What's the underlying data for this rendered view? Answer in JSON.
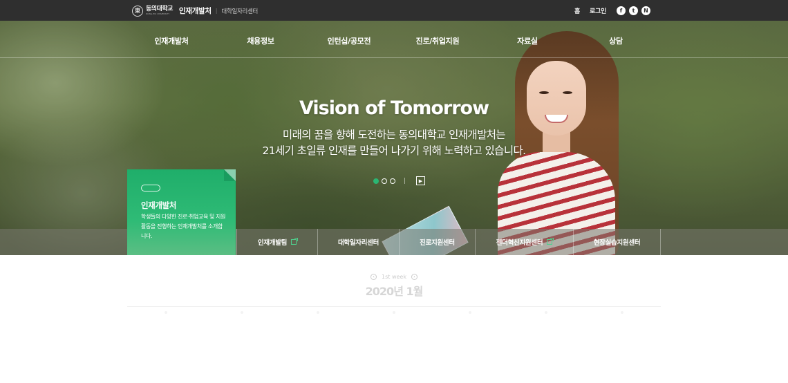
{
  "topbar": {
    "university_name": "동의대학교",
    "university_name_en": "DONG-EUI UNIVERSITY",
    "brand": "인재개발처",
    "separator": "|",
    "sub_brand": "대학일자리센터",
    "home_label": "홈",
    "login_label": "로그인",
    "sns": [
      {
        "icon": "facebook-icon",
        "glyph": "f"
      },
      {
        "icon": "twitter-icon",
        "glyph": "t"
      },
      {
        "icon": "naver-icon",
        "glyph": "N"
      }
    ]
  },
  "nav": {
    "items": [
      "인재개발처",
      "채용정보",
      "인턴십/공모전",
      "진로/취업지원",
      "자료실",
      "상담"
    ]
  },
  "hero": {
    "headline": "Vision of Tomorrow",
    "line1": "미래의 꿈을 향해 도전하는 동의대학교 인재개발처는",
    "line2": "21세기 초일류 인재를 만들어 나가기 위해 노력하고 있습니다.",
    "slides_total": 3,
    "slide_active": 1,
    "accent_color": "#2bb673"
  },
  "card": {
    "title": "인재개발처",
    "description": "학생들의 다양한 진로·취업교육 및 지원 활동을 진행하는 인재개발처를 소개합니다."
  },
  "quicklinks": [
    {
      "label": "인재개발팀",
      "external": true
    },
    {
      "label": "대학일자리센터",
      "external": false
    },
    {
      "label": "진로지원센터",
      "external": false
    },
    {
      "label": "젠더혁신지원센터",
      "external": true
    },
    {
      "label": "현장실습지원센터",
      "external": false
    }
  ],
  "calendar": {
    "week_label": "1st week",
    "month_label": "2020년 1월"
  }
}
